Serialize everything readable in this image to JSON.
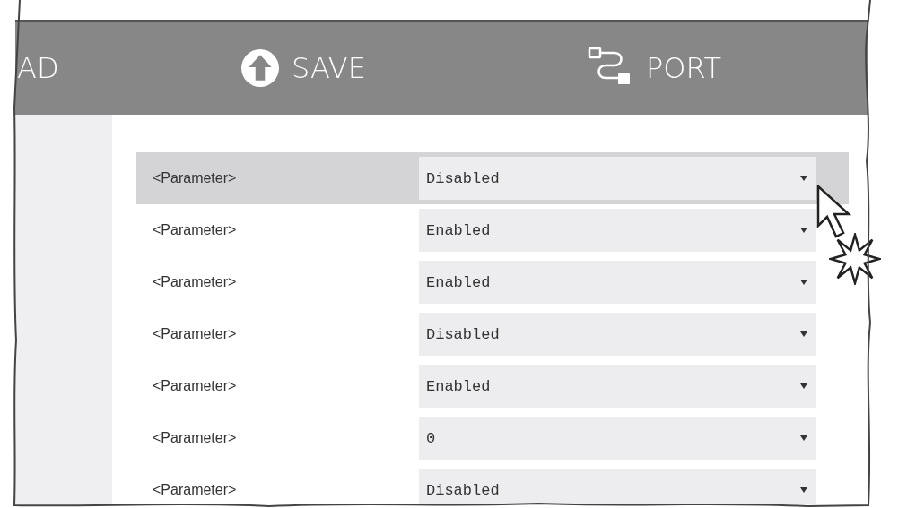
{
  "toolbar": [
    {
      "label": "AD",
      "kind": "text"
    },
    {
      "label": "SAVE",
      "kind": "upload"
    },
    {
      "label": "PORT",
      "kind": "cable"
    }
  ],
  "parameters": [
    {
      "label": "<Parameter>",
      "value": "Disabled",
      "selected": true
    },
    {
      "label": "<Parameter>",
      "value": "Enabled",
      "selected": false
    },
    {
      "label": "<Parameter>",
      "value": "Enabled",
      "selected": false
    },
    {
      "label": "<Parameter>",
      "value": "Disabled",
      "selected": false
    },
    {
      "label": "<Parameter>",
      "value": "Enabled",
      "selected": false
    },
    {
      "label": "<Parameter>",
      "value": "0",
      "selected": false
    },
    {
      "label": "<Parameter>",
      "value": "Disabled",
      "selected": false
    }
  ]
}
